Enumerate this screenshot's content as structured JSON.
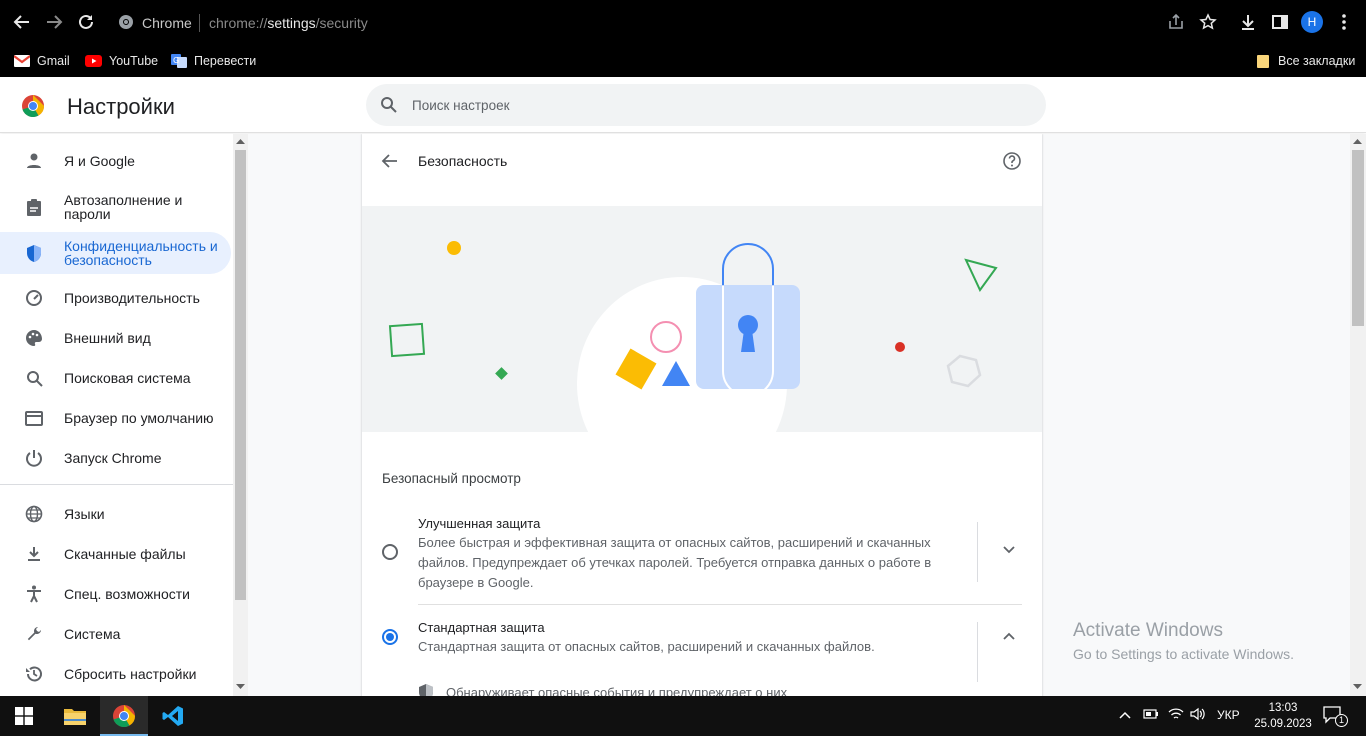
{
  "browser": {
    "omnibox": {
      "site_label": "Chrome",
      "url_prefix": "chrome://",
      "url_host": "settings",
      "url_path": "/security"
    },
    "profile_initial": "Н",
    "profile_color": "#1a73e8"
  },
  "bookmarks": {
    "items": [
      {
        "label": "Gmail",
        "icon": "gmail-icon",
        "color": "#ea4335"
      },
      {
        "label": "YouTube",
        "icon": "youtube-icon",
        "color": "#ff0000"
      },
      {
        "label": "Перевести",
        "icon": "translate-icon",
        "color": "#4285f4"
      }
    ],
    "all_bookmarks": "Все закладки"
  },
  "settings": {
    "title": "Настройки",
    "search_placeholder": "Поиск настроек"
  },
  "sidebar": {
    "items": [
      {
        "label": "Я и Google",
        "icon": "person-icon"
      },
      {
        "label": "Автозаполнение и пароли",
        "icon": "clipboard-icon"
      },
      {
        "label": "Конфиденциальность и безопасность",
        "icon": "shield-icon",
        "active": true
      },
      {
        "label": "Производительность",
        "icon": "speedometer-icon"
      },
      {
        "label": "Внешний вид",
        "icon": "palette-icon"
      },
      {
        "label": "Поисковая система",
        "icon": "search-icon"
      },
      {
        "label": "Браузер по умолчанию",
        "icon": "browser-icon"
      },
      {
        "label": "Запуск Chrome",
        "icon": "power-icon"
      },
      {
        "label": "Языки",
        "icon": "globe-icon"
      },
      {
        "label": "Скачанные файлы",
        "icon": "download-icon"
      },
      {
        "label": "Спец. возможности",
        "icon": "accessibility-icon"
      },
      {
        "label": "Система",
        "icon": "wrench-icon"
      },
      {
        "label": "Сбросить настройки",
        "icon": "history-icon"
      }
    ]
  },
  "page": {
    "title": "Безопасность",
    "section_title": "Безопасный просмотр",
    "options": [
      {
        "title": "Улучшенная защита",
        "description": "Более быстрая и эффективная защита от опасных сайтов, расширений и скачанных файлов. Предупреждает об утечках паролей. Требуется отправка данных о работе в браузере в Google.",
        "checked": false
      },
      {
        "title": "Стандартная защита",
        "description": "Стандартная защита от опасных сайтов, расширений и скачанных файлов.",
        "checked": true
      }
    ],
    "sub_item": "Обнаруживает опасные события и предупреждает о них"
  },
  "watermark": {
    "line1": "Activate Windows",
    "line2": "Go to Settings to activate Windows."
  },
  "taskbar": {
    "language": "УКР",
    "time": "13:03",
    "date": "25.09.2023",
    "notification_count": "1"
  }
}
